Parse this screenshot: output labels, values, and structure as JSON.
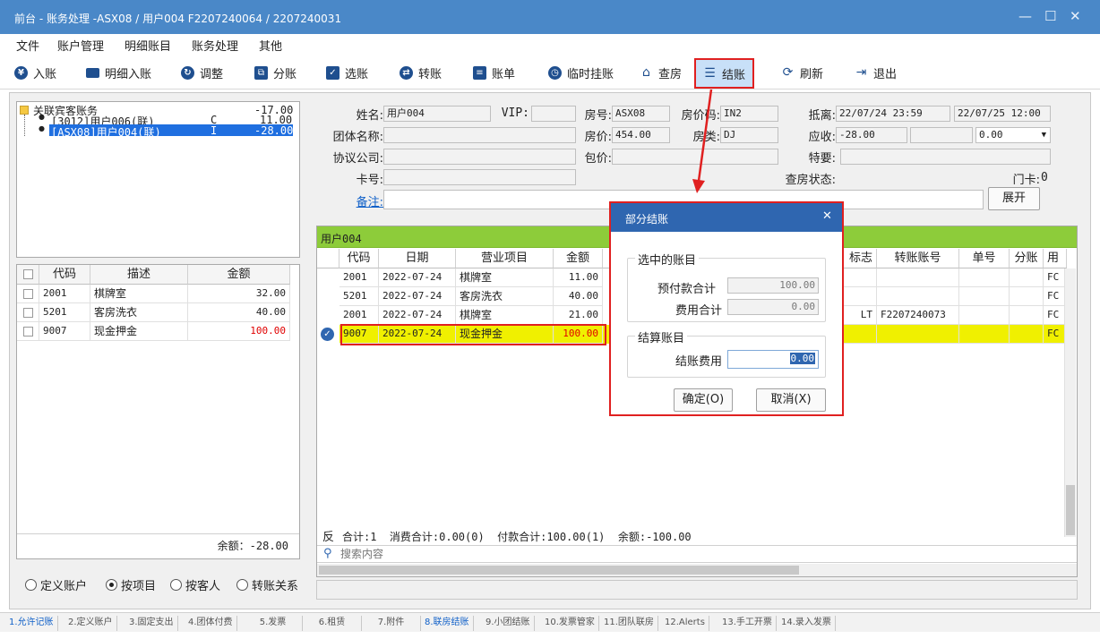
{
  "window": {
    "title": "前台 - 账务处理 -ASX08 / 用户004 F2207240064 / 2207240031",
    "minimize": "—",
    "maximize": "☐",
    "close": "✕"
  },
  "menu": [
    "文件",
    "账户管理",
    "明细账目",
    "账务处理",
    "其他"
  ],
  "toolbar": {
    "post": "入账",
    "detail_post": "明细入账",
    "adjust": "调整",
    "split": "分账",
    "select": "选账",
    "transfer": "转账",
    "bill": "账单",
    "temp_hang": "临时挂账",
    "check_room": "查房",
    "checkout": "结账",
    "refresh": "刷新",
    "exit": "退出"
  },
  "tree": {
    "root_label": "关联宾客账务",
    "root_amount": "-17.00",
    "children": [
      {
        "label": "[3012]用户006(联)",
        "flag": "C",
        "amount": "11.00"
      },
      {
        "label": "[ASX08]用户004(联)",
        "flag": "I",
        "amount": "-28.00"
      }
    ]
  },
  "left_table": {
    "headers": [
      "代码",
      "描述",
      "金额"
    ],
    "rows": [
      {
        "code": "2001",
        "desc": "棋牌室",
        "amount": "32.00"
      },
      {
        "code": "5201",
        "desc": "客房洗衣",
        "amount": "40.00"
      },
      {
        "code": "9007",
        "desc": "现金押金",
        "amount": "100.00"
      }
    ],
    "balance": "余额：-28.00"
  },
  "radios": [
    {
      "label": "定义账户",
      "checked": false
    },
    {
      "label": "按项目",
      "checked": true
    },
    {
      "label": "按客人",
      "checked": false
    },
    {
      "label": "转账关系",
      "checked": false
    }
  ],
  "form": {
    "name_label": "姓名:",
    "name": "用户004",
    "vip_label": "VIP:",
    "vip": "",
    "room_label": "房号:",
    "room": "ASX08",
    "rate_code_label": "房价码:",
    "rate_code": "IN2",
    "depart_label": "抵离:",
    "arrive": "22/07/24 23:59",
    "leave": "22/07/25 12:00",
    "group_label": "团体名称:",
    "group": "",
    "price_label": "房价:",
    "price": "454.00",
    "room_type_label": "房类:",
    "room_type": "DJ",
    "receivable_label": "应收:",
    "receivable": "-28.00",
    "receivable_extra": "0.00",
    "agreement_label": "协议公司:",
    "agreement": "",
    "package_label": "包价:",
    "package": "",
    "special_label": "特要:",
    "special": "",
    "card_label": "卡号:",
    "card": "",
    "check_status_label": "查房状态:",
    "door_card_label": "门卡:",
    "door_card": "0",
    "remark_label": "备注:",
    "expand_button": "展开"
  },
  "grid": {
    "account_name": "用户004",
    "headers": [
      "代码",
      "日期",
      "营业项目",
      "金额",
      "标志",
      "转账账号",
      "单号",
      "分账",
      "用"
    ],
    "rows": [
      {
        "code": "2001",
        "date": "2022-07-24",
        "item": "棋牌室",
        "amount": "11.00",
        "flag": "",
        "transfer": "",
        "no": "",
        "split": "",
        "user": "FC"
      },
      {
        "code": "5201",
        "date": "2022-07-24",
        "item": "客房洗衣",
        "amount": "40.00",
        "flag": "",
        "transfer": "",
        "no": "",
        "split": "",
        "user": "FC"
      },
      {
        "code": "2001",
        "date": "2022-07-24",
        "item": "棋牌室",
        "amount": "21.00",
        "flag": "LT",
        "transfer": "F2207240073",
        "no": "",
        "split": "",
        "user": "FC"
      },
      {
        "code": "9007",
        "date": "2022-07-24",
        "item": "现金押金",
        "amount": "100.00",
        "flag": "",
        "transfer": "",
        "no": "",
        "split": "",
        "user": "FC"
      }
    ],
    "summary_prefix": "反",
    "summary": "合计:1  消费合计:0.00(0)  付款合计:100.00(1)  余额:-100.00",
    "search_placeholder": "搜索内容"
  },
  "dialog": {
    "title": "部分结账",
    "close": "✕",
    "selected_group": "选中的账目",
    "prepaid_label": "预付款合计",
    "prepaid": "100.00",
    "fee_label": "费用合计",
    "fee": "0.00",
    "settle_group": "结算账目",
    "settle_label": "结账费用",
    "settle_value": "0.00",
    "ok": "确定(O)",
    "cancel": "取消(X)"
  },
  "tabs": [
    "1.允许记账",
    "2.定义账户",
    "3.固定支出",
    "4.团体付费",
    "5.发票",
    "6.租赁",
    "7.附件",
    "8.联房结账",
    "9.小团结账",
    "10.发票管家",
    "11.团队联房",
    "12.Alerts",
    "13.手工开票",
    "14.录入发票"
  ],
  "active_tab": 7,
  "colors": {
    "title_bar": "#4a88c8",
    "dialog_title": "#2f66b0",
    "selection": "#1f6fe0",
    "highlight_row": "#f0f000",
    "grid_header": "#8dcc3a",
    "annotation": "#e02020"
  }
}
